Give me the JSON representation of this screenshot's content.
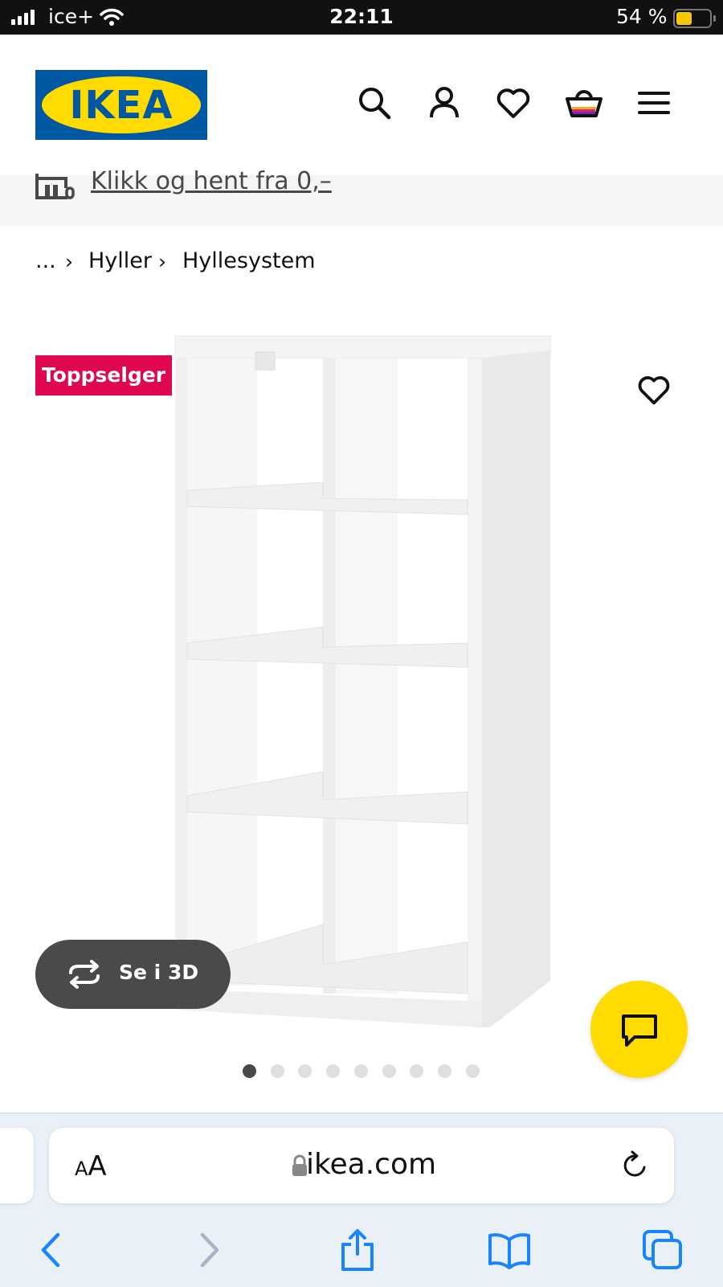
{
  "status_bar": {
    "carrier": "ice+",
    "time": "22:11",
    "battery": "54 %",
    "battery_level": 0.54
  },
  "header": {
    "logo_text": "IKEA",
    "icons": [
      "search-icon",
      "account-icon",
      "wishlist-heart-icon",
      "shopping-basket-icon",
      "menu-icon"
    ]
  },
  "promo": {
    "text": "Klikk og hent fra 0,–"
  },
  "breadcrumb": {
    "ellipsis": "...",
    "items": [
      "Hyller",
      "Hyllesystem"
    ]
  },
  "product": {
    "badge": "Toppselger",
    "view_3d_label": "Se i 3D",
    "carousel": {
      "total": 9,
      "active": 1
    }
  },
  "browser": {
    "aa_small": "A",
    "aa_big": "A",
    "domain": "ikea.com"
  },
  "colors": {
    "ikea_blue": "#0058a3",
    "ikea_yellow": "#ffdb00",
    "badge_red": "#e00751",
    "ios_blue": "#1a84ff"
  }
}
